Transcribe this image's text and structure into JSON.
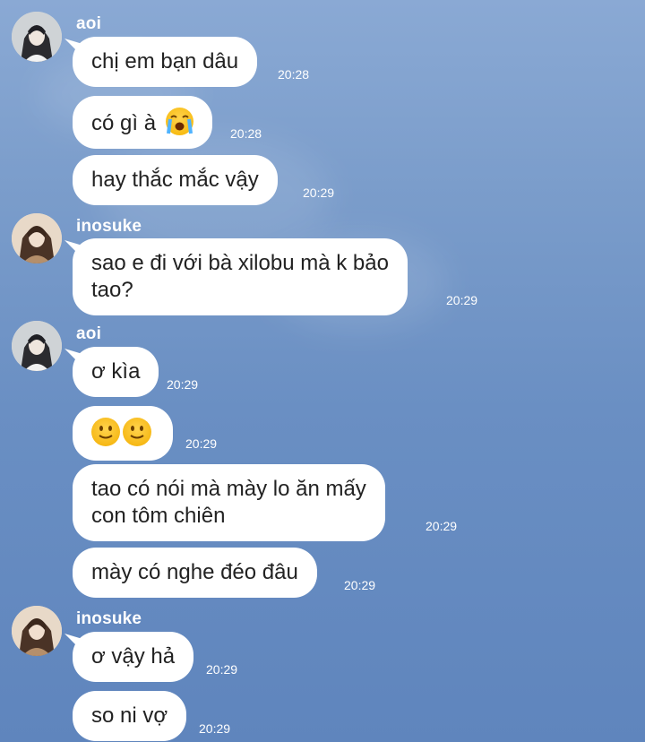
{
  "chat": {
    "messages": [
      {
        "sender": "aoi",
        "text": "chị em bạn dâu",
        "time": "20:28"
      },
      {
        "sender": "aoi",
        "text": "có gì à",
        "time": "20:28",
        "emoji": "loudly-crying-face"
      },
      {
        "sender": "aoi",
        "text": "hay thắc mắc vậy",
        "time": "20:29"
      },
      {
        "sender": "inosuke",
        "line1": "sao e đi với bà xilobu mà k bảo",
        "line2": "tao?",
        "time": "20:29"
      },
      {
        "sender": "aoi",
        "text": "ơ kìa",
        "time": "20:29"
      },
      {
        "sender": "aoi",
        "emoji": "slightly-smiling-face-x2",
        "time": "20:29"
      },
      {
        "sender": "aoi",
        "line1": "tao có nói mà mày lo ăn mấy",
        "line2": "con tôm chiên",
        "time": "20:29"
      },
      {
        "sender": "aoi",
        "text": "mày có nghe đéo đâu",
        "time": "20:29"
      },
      {
        "sender": "inosuke",
        "text": "ơ vậy hả",
        "time": "20:29"
      },
      {
        "sender": "inosuke",
        "text": "so ni vợ",
        "time": "20:29"
      }
    ]
  },
  "senders": {
    "aoi": "aoi",
    "inosuke": "inosuke"
  },
  "colors": {
    "background": "#6a8fc3",
    "bubble": "#ffffff",
    "text": "#222222",
    "meta": "#ffffff"
  }
}
